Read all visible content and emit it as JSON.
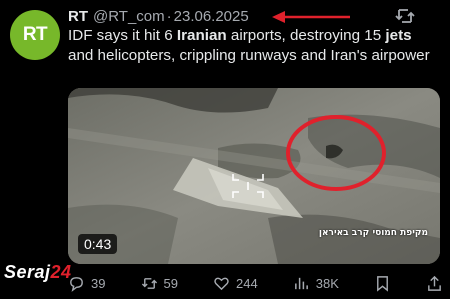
{
  "tweet": {
    "author_name": "RT",
    "handle": "@RT_com",
    "separator": "·",
    "date": "23.06.2025",
    "avatar_text": "RT",
    "text_segments": [
      {
        "text": "IDF says it hit 6 ",
        "bold": false
      },
      {
        "text": "Iranian",
        "bold": true
      },
      {
        "text": " airports, destroying 15 ",
        "bold": false
      },
      {
        "text": "jets",
        "bold": true
      },
      {
        "text": " and helicopters, crippling runways and Iran's airpower",
        "bold": false
      }
    ]
  },
  "media": {
    "duration": "0:43",
    "watermark": "מקיפת חמוסי קרב באיראן"
  },
  "actions": {
    "replies": "39",
    "reposts": "59",
    "likes": "244",
    "views": "38K"
  },
  "brand_overlay": {
    "logo_text": "Seraj24"
  },
  "colors": {
    "avatar_green": "#77b82a",
    "annotation_red": "#e0212c",
    "background": "#000000",
    "muted_text": "#a6aab0"
  },
  "icons": [
    "repost-icon",
    "reply-icon",
    "retweet-icon",
    "like-icon",
    "views-icon",
    "bookmark-icon",
    "share-icon"
  ]
}
